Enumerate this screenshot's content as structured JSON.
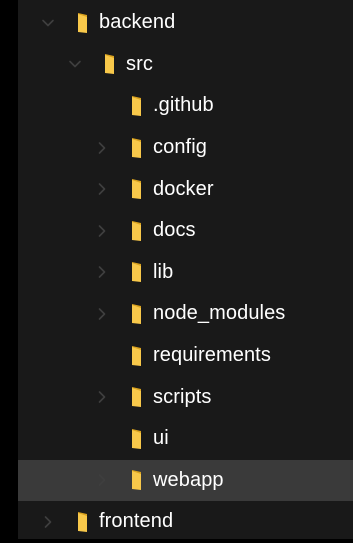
{
  "tree": {
    "items": [
      {
        "label": "backend",
        "depth": 1,
        "expander": "expanded",
        "icon": "folder-icon",
        "selected": false
      },
      {
        "label": "src",
        "depth": 2,
        "expander": "expanded",
        "icon": "folder-icon",
        "selected": false
      },
      {
        "label": ".github",
        "depth": 3,
        "expander": "none",
        "icon": "folder-icon",
        "selected": false
      },
      {
        "label": "config",
        "depth": 3,
        "expander": "collapsed",
        "icon": "folder-icon",
        "selected": false
      },
      {
        "label": "docker",
        "depth": 3,
        "expander": "collapsed",
        "icon": "folder-icon",
        "selected": false
      },
      {
        "label": "docs",
        "depth": 3,
        "expander": "collapsed",
        "icon": "folder-icon",
        "selected": false
      },
      {
        "label": "lib",
        "depth": 3,
        "expander": "collapsed",
        "icon": "folder-icon",
        "selected": false
      },
      {
        "label": "node_modules",
        "depth": 3,
        "expander": "collapsed",
        "icon": "folder-icon",
        "selected": false
      },
      {
        "label": "requirements",
        "depth": 3,
        "expander": "none",
        "icon": "folder-icon",
        "selected": false
      },
      {
        "label": "scripts",
        "depth": 3,
        "expander": "collapsed",
        "icon": "folder-icon",
        "selected": false
      },
      {
        "label": "ui",
        "depth": 3,
        "expander": "none",
        "icon": "folder-icon",
        "selected": false
      },
      {
        "label": "webapp",
        "depth": 3,
        "expander": "collapsed",
        "icon": "folder-icon",
        "selected": true
      },
      {
        "label": "frontend",
        "depth": 1,
        "expander": "collapsed",
        "icon": "folder-icon",
        "selected": false
      }
    ]
  },
  "colors": {
    "background": "#191919",
    "outer": "#000000",
    "selected_row": "#3a3a3a",
    "text": "#ffffff",
    "chevron": "#3f3f3f",
    "folder_front": "#f8c84a",
    "folder_back": "#d9a21f"
  }
}
